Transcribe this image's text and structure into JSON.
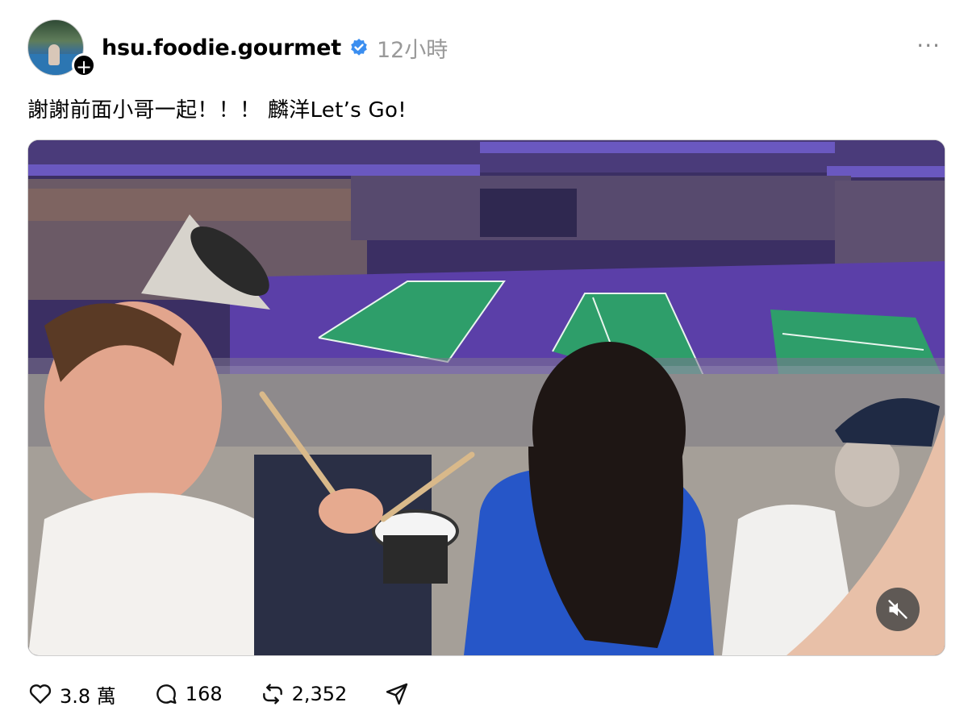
{
  "post": {
    "username": "hsu.foodie.gourmet",
    "time": "12小時",
    "caption": "謝謝前面小哥一起！！！ 麟洋Let’s Go!",
    "more_label": "···"
  },
  "icons": {
    "verified": "verified-badge-icon",
    "follow": "plus-icon",
    "mute": "speaker-muted-icon",
    "like": "heart-icon",
    "reply": "comment-bubble-icon",
    "repost": "repost-icon",
    "share": "send-icon"
  },
  "stats": {
    "likes": "3.8 萬",
    "replies": "168",
    "reposts": "2,352"
  },
  "colors": {
    "verified": "#3a8ef0",
    "arena_purple": "#5b3fa8",
    "court_green": "#2e9e6a"
  }
}
